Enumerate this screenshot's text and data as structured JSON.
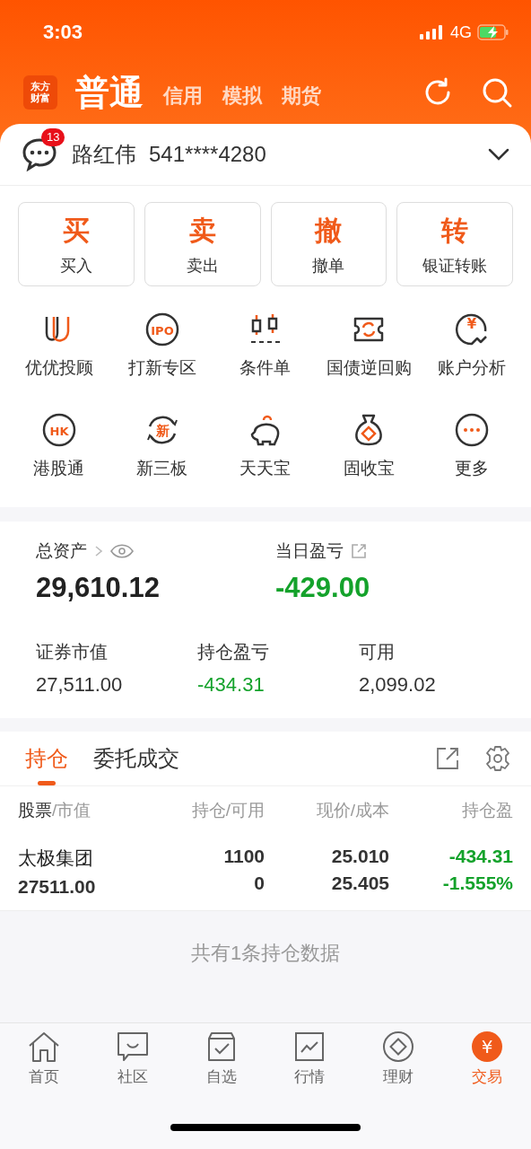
{
  "status_bar": {
    "time": "3:03",
    "network": "4G"
  },
  "header": {
    "logo": [
      "东方",
      "财富"
    ],
    "tabs": [
      {
        "label": "普通",
        "selected": true
      },
      {
        "label": "信用",
        "selected": false
      },
      {
        "label": "模拟",
        "selected": false
      },
      {
        "label": "期货",
        "selected": false
      }
    ]
  },
  "account": {
    "badge": "13",
    "name": "路红伟",
    "number": "541****4280"
  },
  "trade_buttons": [
    {
      "glyph": "买",
      "label": "买入"
    },
    {
      "glyph": "卖",
      "label": "卖出"
    },
    {
      "glyph": "撤",
      "label": "撤单"
    },
    {
      "glyph": "转",
      "label": "银证转账"
    }
  ],
  "shortcuts": [
    {
      "label": "优优投顾"
    },
    {
      "label": "打新专区",
      "icon_text": "IPO"
    },
    {
      "label": "条件单"
    },
    {
      "label": "国债逆回购"
    },
    {
      "label": "账户分析",
      "icon_text": "¥"
    },
    {
      "label": "港股通",
      "icon_text": "HK"
    },
    {
      "label": "新三板",
      "icon_text": "新"
    },
    {
      "label": "天天宝"
    },
    {
      "label": "固收宝"
    },
    {
      "label": "更多"
    }
  ],
  "assets": {
    "total": {
      "label": "总资产",
      "value": "29,610.12"
    },
    "daily_pnl": {
      "label": "当日盈亏",
      "value": "-429.00",
      "color": "#14a22b"
    },
    "stats": [
      {
        "label": "证券市值",
        "value": "27,511.00",
        "color": "#333333"
      },
      {
        "label": "持仓盈亏",
        "value": "-434.31",
        "color": "#14a22b"
      },
      {
        "label": "可用",
        "value": "2,099.02",
        "color": "#333333"
      }
    ]
  },
  "positions": {
    "tabs": [
      {
        "label": "持仓",
        "selected": true
      },
      {
        "label": "委托成交",
        "selected": false
      }
    ],
    "columns": [
      {
        "main": "股票",
        "sub": "/市值"
      },
      {
        "main": "持仓",
        "sub": "/可用"
      },
      {
        "main": "现价",
        "sub": "/成本"
      },
      {
        "main": "持仓盈"
      }
    ],
    "rows": [
      {
        "name": "太极集团",
        "market_value": "27511.00",
        "quantity": "1100",
        "available": "0",
        "price": "25.010",
        "cost": "25.405",
        "pnl": "-434.31",
        "pnl_pct": "-1.555%",
        "color": "#14a22b"
      }
    ],
    "footer": "共有1条持仓数据"
  },
  "tab_bar": [
    {
      "label": "首页",
      "selected": false
    },
    {
      "label": "社区",
      "selected": false
    },
    {
      "label": "自选",
      "selected": false
    },
    {
      "label": "行情",
      "selected": false
    },
    {
      "label": "理财",
      "selected": false
    },
    {
      "label": "交易",
      "selected": true,
      "icon_text": "¥"
    }
  ]
}
